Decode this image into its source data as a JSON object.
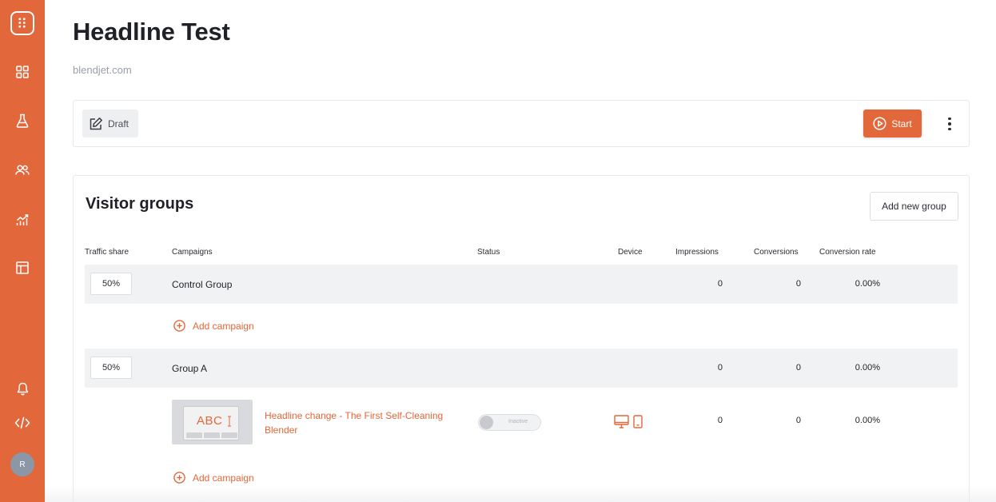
{
  "sidebar": {
    "logo_icon": "app-grid-icon",
    "items": [
      {
        "icon": "dashboard-icon"
      },
      {
        "icon": "flask-icon"
      },
      {
        "icon": "users-icon"
      },
      {
        "icon": "analytics-icon"
      },
      {
        "icon": "layout-icon"
      }
    ],
    "bottom": [
      {
        "icon": "bell-icon"
      },
      {
        "icon": "code-icon"
      }
    ],
    "avatar_initial": "R",
    "color": "#e2673a"
  },
  "page": {
    "title": "Headline Test",
    "subtitle": "blendjet.com"
  },
  "toolbar": {
    "status_label": "Draft",
    "start_label": "Start"
  },
  "visitor_groups": {
    "title": "Visitor groups",
    "add_group_label": "Add new group",
    "columns": {
      "traffic_share": "Traffic share",
      "campaigns": "Campaigns",
      "status": "Status",
      "device": "Device",
      "impressions": "Impressions",
      "conversions": "Conversions",
      "conversion_rate": "Conversion rate"
    },
    "add_campaign_label": "Add campaign",
    "groups": [
      {
        "share": "50%",
        "name": "Control Group",
        "impressions": "0",
        "conversions": "0",
        "conversion_rate": "0.00%"
      },
      {
        "share": "50%",
        "name": "Group A",
        "impressions": "0",
        "conversions": "0",
        "conversion_rate": "0.00%"
      }
    ],
    "campaign": {
      "thumbnail_text": "ABC",
      "name": "Headline change - The First Self-Cleaning Blender",
      "status": "Inactive",
      "devices": [
        "desktop-icon",
        "mobile-icon"
      ],
      "impressions": "0",
      "conversions": "0",
      "conversion_rate": "0.00%"
    }
  }
}
